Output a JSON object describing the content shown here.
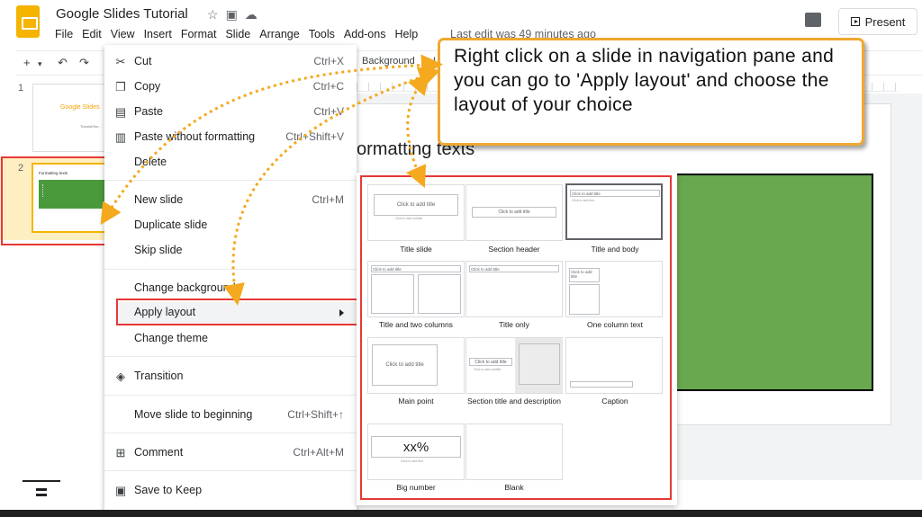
{
  "app": {
    "doc_title": "Google Slides Tutorial",
    "menu": [
      "File",
      "Edit",
      "View",
      "Insert",
      "Format",
      "Slide",
      "Arrange",
      "Tools",
      "Add-ons",
      "Help"
    ],
    "last_edit": "Last edit was 49 minutes ago",
    "present_label": "Present",
    "accent_color": "#f4b400"
  },
  "toolbar": {
    "add_label": "+",
    "background_label": "Background",
    "layout_fragment": "L"
  },
  "filmstrip": {
    "slides": [
      {
        "number": "1",
        "title": "Google Slides",
        "subtitle": "TutorialShe..."
      },
      {
        "number": "2",
        "title": "Formatting texts"
      }
    ]
  },
  "slide": {
    "heading": "ormatting texts",
    "shape_color": "#6aa84f"
  },
  "context_menu": {
    "items": [
      {
        "label": "Cut",
        "shortcut": "Ctrl+X",
        "icon": "cut-icon"
      },
      {
        "label": "Copy",
        "shortcut": "Ctrl+C",
        "icon": "copy-icon"
      },
      {
        "label": "Paste",
        "shortcut": "Ctrl+V",
        "icon": "paste-icon"
      },
      {
        "label": "Paste without formatting",
        "shortcut": "Ctrl+Shift+V",
        "icon": "paste-plain-icon"
      },
      {
        "label": "Delete",
        "shortcut": ""
      },
      {
        "label": "New slide",
        "shortcut": "Ctrl+M"
      },
      {
        "label": "Duplicate slide",
        "shortcut": ""
      },
      {
        "label": "Skip slide",
        "shortcut": ""
      },
      {
        "label": "Change background",
        "shortcut": ""
      },
      {
        "label": "Apply layout",
        "shortcut": ""
      },
      {
        "label": "Change theme",
        "shortcut": ""
      },
      {
        "label": "Transition",
        "shortcut": "",
        "icon": "transition-icon"
      },
      {
        "label": "Move slide to beginning",
        "shortcut": "Ctrl+Shift+↑"
      },
      {
        "label": "Comment",
        "shortcut": "Ctrl+Alt+M",
        "icon": "comment-icon"
      },
      {
        "label": "Save to Keep",
        "shortcut": "",
        "icon": "keep-icon"
      }
    ]
  },
  "layouts": {
    "items": [
      {
        "name": "Title slide"
      },
      {
        "name": "Section header"
      },
      {
        "name": "Title and body"
      },
      {
        "name": "Title and two columns"
      },
      {
        "name": "Title only"
      },
      {
        "name": "One column text"
      },
      {
        "name": "Main point"
      },
      {
        "name": "Section title and description"
      },
      {
        "name": "Caption"
      },
      {
        "name": "Big number"
      },
      {
        "name": "Blank"
      }
    ],
    "placeholder_title": "Click to add title",
    "placeholder_subtitle": "Click to add subtitle",
    "placeholder_text": "Click to add text",
    "big_number": "xx%",
    "selected": "Title and body"
  },
  "callout": {
    "text": "Right click on a slide in navigation pane and you can go to 'Apply layout' and choose the layout of your choice",
    "border_color": "#f0a830",
    "highlight_color": "#e53935"
  }
}
